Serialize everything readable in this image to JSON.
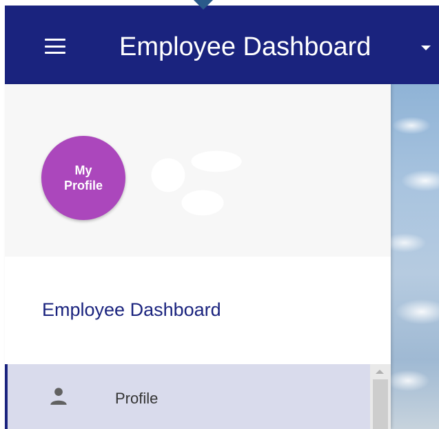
{
  "appbar": {
    "title": "Employee Dashboard",
    "menu_icon": "hamburger-menu-icon",
    "dropdown_icon": "caret-down-icon",
    "background": "#1a237e"
  },
  "drawer": {
    "avatar": {
      "line1": "My",
      "line2": "Profile",
      "color": "#ab47bc"
    },
    "heading": "Employee Dashboard",
    "items": [
      {
        "label": "Profile",
        "icon": "person-icon",
        "selected": true
      }
    ]
  }
}
